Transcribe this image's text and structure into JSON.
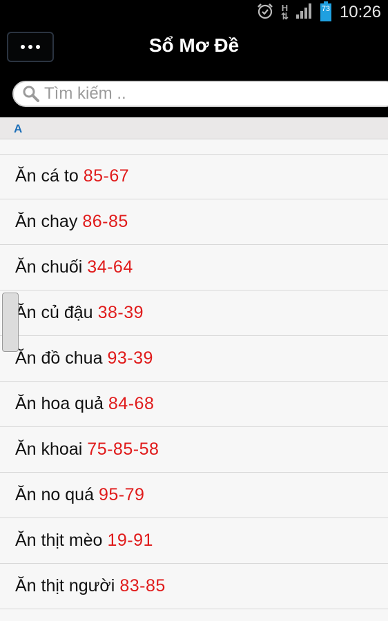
{
  "status_bar": {
    "time": "10:26",
    "battery_level": "73",
    "network": "H",
    "icons": [
      "alarm-clock-icon",
      "data-arrows-icon",
      "signal-icon",
      "battery-icon"
    ]
  },
  "header": {
    "title": "Sổ Mơ Đề",
    "menu_icon": "more-dots-icon"
  },
  "search": {
    "placeholder": "Tìm kiếm ..",
    "value": ""
  },
  "section": {
    "letter": "A"
  },
  "items": [
    {
      "label": "Ăn cá to",
      "numbers": "85-67"
    },
    {
      "label": "Ăn chay",
      "numbers": "86-85"
    },
    {
      "label": "Ăn chuối",
      "numbers": "34-64"
    },
    {
      "label": "Ăn củ đậu",
      "numbers": "38-39"
    },
    {
      "label": "Ăn đồ chua",
      "numbers": "93-39"
    },
    {
      "label": "Ăn hoa quả",
      "numbers": "84-68"
    },
    {
      "label": "Ăn khoai",
      "numbers": "75-85-58"
    },
    {
      "label": "Ăn no quá",
      "numbers": "95-79"
    },
    {
      "label": "Ăn thịt mèo",
      "numbers": "19-91"
    },
    {
      "label": "Ăn thịt người",
      "numbers": "83-85"
    }
  ],
  "colors": {
    "number": "#e01b1b",
    "section_letter": "#1d6fb8",
    "battery": "#1fa0e0"
  }
}
